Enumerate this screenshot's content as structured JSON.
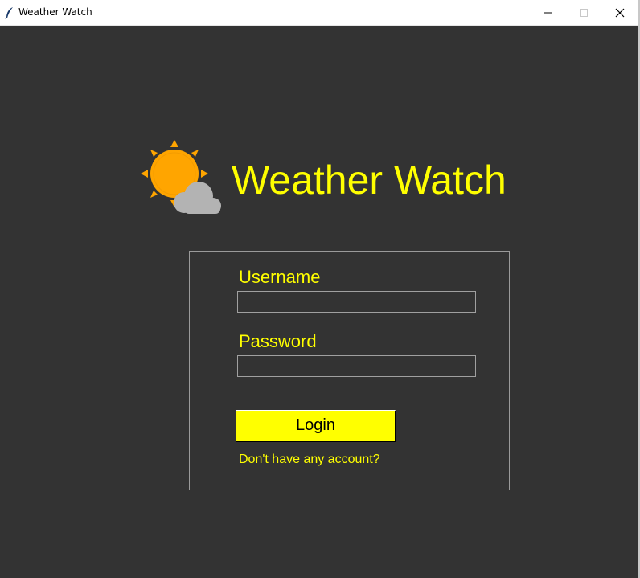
{
  "window": {
    "title": "Weather Watch"
  },
  "header": {
    "app_name": "Weather Watch",
    "icon": "sun-behind-cloud-icon"
  },
  "login_form": {
    "username_label": "Username",
    "username_value": "",
    "password_label": "Password",
    "password_value": "",
    "login_button_label": "Login",
    "signup_link_text": "Don't have any account?"
  },
  "colors": {
    "background": "#333333",
    "accent": "#ffff00",
    "sun": "#ffa500",
    "cloud": "#b0b0b0",
    "frame_border": "#9a9a9a"
  }
}
